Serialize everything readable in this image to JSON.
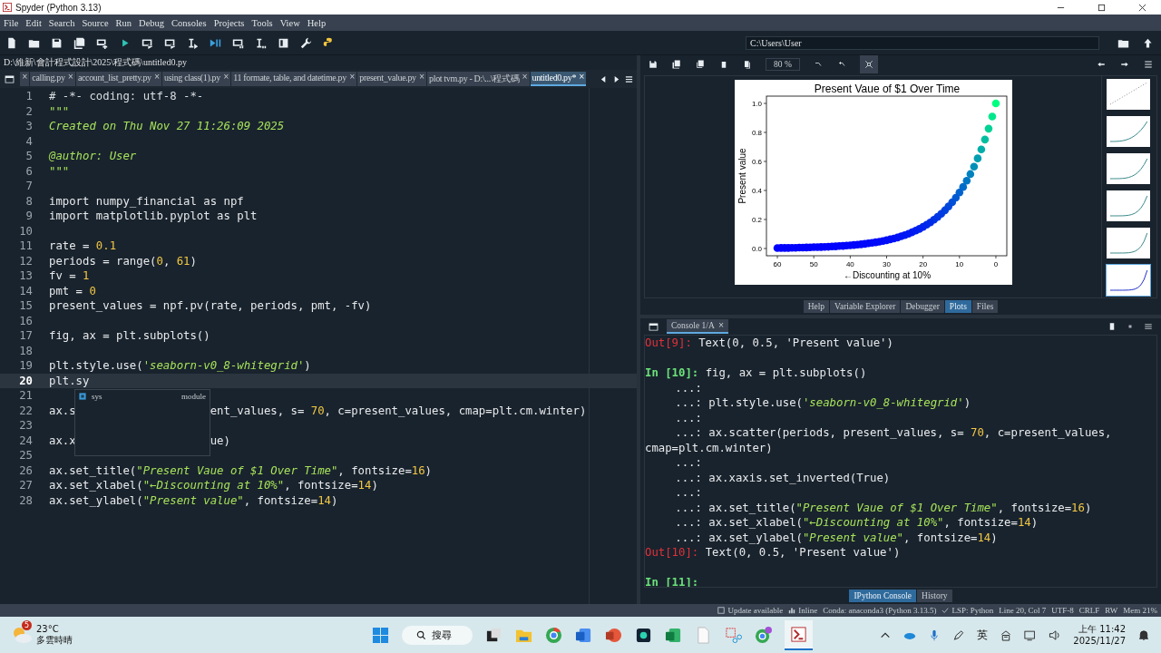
{
  "window": {
    "title": "Spyder (Python 3.13)"
  },
  "menu": [
    "File",
    "Edit",
    "Search",
    "Source",
    "Run",
    "Debug",
    "Consoles",
    "Projects",
    "Tools",
    "View",
    "Help"
  ],
  "working_dir": {
    "value": "C:\\Users\\User"
  },
  "editor": {
    "path": "D:\\維新\\會計程式設計\\2025\\程式碼\\untitled0.py",
    "tabs": [
      {
        "close": "×",
        "selected": false
      },
      {
        "label": "calling.py",
        "close": "×",
        "selected": false
      },
      {
        "label": "account_list_pretty.py",
        "close": "×",
        "selected": false
      },
      {
        "label": "using class(1).py",
        "close": "×",
        "selected": false
      },
      {
        "label": "11 formate, table, and datetime.py",
        "close": "×",
        "selected": false
      },
      {
        "label": "present_value.py",
        "close": "×",
        "selected": false
      },
      {
        "label": "plot tvm.py - D:\\...\\程式碼",
        "close": "×",
        "selected": false
      },
      {
        "label": "untitled0.py*",
        "close": "×",
        "selected": true
      }
    ],
    "lines": [
      {
        "n": "1",
        "tokens": [
          {
            "t": "# -*- coding: utf-8 -*-",
            "kind": "com"
          }
        ]
      },
      {
        "n": "2",
        "tokens": [
          {
            "t": "\"\"\"",
            "kind": "str"
          }
        ]
      },
      {
        "n": "3",
        "tokens": [
          {
            "t": "Created on Thu Nov 27 11:26:09 2025",
            "kind": "str"
          }
        ]
      },
      {
        "n": "4"
      },
      {
        "n": "5",
        "tokens": [
          {
            "t": "@author: User",
            "kind": "str"
          }
        ]
      },
      {
        "n": "6",
        "tokens": [
          {
            "t": "\"\"\"",
            "kind": "str"
          }
        ]
      },
      {
        "n": "7"
      },
      {
        "n": "8",
        "tokens": [
          {
            "t": "import numpy_financial as npf"
          }
        ]
      },
      {
        "n": "9",
        "tokens": [
          {
            "t": "import matplotlib.pyplot as plt"
          }
        ]
      },
      {
        "n": "10"
      },
      {
        "n": "11",
        "tokens": [
          {
            "t": "rate = "
          },
          {
            "t": "0.1",
            "kind": "num"
          }
        ]
      },
      {
        "n": "12",
        "tokens": [
          {
            "t": "periods = range("
          },
          {
            "t": "0",
            "kind": "num"
          },
          {
            "t": ", "
          },
          {
            "t": "61",
            "kind": "num"
          },
          {
            "t": ")"
          }
        ]
      },
      {
        "n": "13",
        "tokens": [
          {
            "t": "fv = "
          },
          {
            "t": "1",
            "kind": "num"
          }
        ]
      },
      {
        "n": "14",
        "tokens": [
          {
            "t": "pmt = "
          },
          {
            "t": "0",
            "kind": "num"
          }
        ]
      },
      {
        "n": "15",
        "tokens": [
          {
            "t": "present_values = npf.pv(rate, periods, pmt, -fv)"
          }
        ]
      },
      {
        "n": "16"
      },
      {
        "n": "17",
        "tokens": [
          {
            "t": "fig, ax = plt.subplots()"
          }
        ]
      },
      {
        "n": "18"
      },
      {
        "n": "19",
        "tokens": [
          {
            "t": "plt.style.use("
          },
          {
            "t": "'seaborn-v0_8-whitegrid'",
            "kind": "str"
          },
          {
            "t": ")"
          }
        ]
      },
      {
        "n": "20",
        "current": true,
        "tokens": [
          {
            "t": "plt.sy"
          }
        ]
      },
      {
        "n": "21"
      },
      {
        "n": "22",
        "covered": true,
        "tokens": [
          {
            "t": "ax.s"
          },
          {
            "t": "ent_values, s= "
          },
          {
            "t": "70",
            "kind": "num"
          },
          {
            "t": ", c=present_values, cmap=plt.cm.winter)"
          }
        ]
      },
      {
        "n": "23"
      },
      {
        "n": "24",
        "covered": true,
        "tokens": [
          {
            "t": "ax.x"
          },
          {
            "t": "ue)"
          }
        ]
      },
      {
        "n": "25"
      },
      {
        "n": "26",
        "tokens": [
          {
            "t": "ax.set_title("
          },
          {
            "t": "\"Present Vaue of $1 Over Time\"",
            "kind": "str"
          },
          {
            "t": ", fontsize="
          },
          {
            "t": "16",
            "kind": "num"
          },
          {
            "t": ")"
          }
        ]
      },
      {
        "n": "27",
        "tokens": [
          {
            "t": "ax.set_xlabel("
          },
          {
            "t": "\"←Discounting at 10%\"",
            "kind": "str"
          },
          {
            "t": ", fontsize="
          },
          {
            "t": "14",
            "kind": "num"
          },
          {
            "t": ")"
          }
        ]
      },
      {
        "n": "28",
        "tokens": [
          {
            "t": "ax.set_ylabel("
          },
          {
            "t": "\"Present value\"",
            "kind": "str"
          },
          {
            "t": ", fontsize="
          },
          {
            "t": "14",
            "kind": "num"
          },
          {
            "t": ")"
          }
        ]
      }
    ],
    "completion": {
      "items": [
        {
          "label": "sys",
          "type": "module"
        }
      ]
    }
  },
  "plots": {
    "zoom": "80 %",
    "chart_data": {
      "type": "scatter",
      "title": "Present Vaue of $1 Over Time",
      "xlabel": "←Discounting at 10%",
      "ylabel": "Present value",
      "x": [
        0,
        1,
        2,
        3,
        4,
        5,
        6,
        7,
        8,
        9,
        10,
        11,
        12,
        13,
        14,
        15,
        16,
        17,
        18,
        19,
        20,
        21,
        22,
        23,
        24,
        25,
        26,
        27,
        28,
        29,
        30,
        31,
        32,
        33,
        34,
        35,
        36,
        37,
        38,
        39,
        40,
        41,
        42,
        43,
        44,
        45,
        46,
        47,
        48,
        49,
        50,
        51,
        52,
        53,
        54,
        55,
        56,
        57,
        58,
        59,
        60
      ],
      "series": [
        {
          "values": [
            1.0,
            0.909,
            0.826,
            0.751,
            0.683,
            0.621,
            0.564,
            0.513,
            0.467,
            0.424,
            0.386,
            0.35,
            0.319,
            0.29,
            0.263,
            0.239,
            0.218,
            0.198,
            0.18,
            0.164,
            0.149,
            0.135,
            0.123,
            0.112,
            0.102,
            0.092,
            0.084,
            0.076,
            0.069,
            0.063,
            0.057,
            0.052,
            0.047,
            0.043,
            0.039,
            0.036,
            0.032,
            0.029,
            0.027,
            0.024,
            0.022,
            0.02,
            0.018,
            0.017,
            0.015,
            0.014,
            0.012,
            0.011,
            0.01,
            0.009,
            0.009,
            0.008,
            0.007,
            0.006,
            0.006,
            0.005,
            0.005,
            0.004,
            0.004,
            0.004,
            0.003
          ]
        }
      ],
      "xlim": [
        63,
        -3
      ],
      "ylim": [
        -0.05,
        1.05
      ],
      "xticks": [
        60,
        50,
        40,
        30,
        20,
        10,
        0
      ],
      "yticks": [
        {
          "value": 0,
          "label": "0.0"
        },
        {
          "value": 0.2,
          "label": "0.2"
        },
        {
          "value": 0.4,
          "label": "0.4"
        },
        {
          "value": 0.6,
          "label": "0.6"
        },
        {
          "value": 0.8,
          "label": "0.8"
        },
        {
          "value": 1,
          "label": "1.0"
        }
      ]
    },
    "thumbnails": [
      {
        "selected": false
      },
      {
        "selected": false
      },
      {
        "selected": false
      },
      {
        "selected": false
      },
      {
        "selected": false
      },
      {
        "selected": true
      }
    ]
  },
  "pane_tabs": [
    {
      "label": "Help",
      "selected": false
    },
    {
      "label": "Variable Explorer",
      "selected": false
    },
    {
      "label": "Debugger",
      "selected": false
    },
    {
      "label": "Plots",
      "selected": true
    },
    {
      "label": "Files",
      "selected": false
    }
  ],
  "console": {
    "tab": {
      "label": "Console 1/A",
      "close": "×"
    },
    "lines": [
      {
        "p": "Out[9]:",
        "kind": "out",
        "tokens": [
          {
            "t": "Text(0, 0.5, 'Present value')"
          }
        ]
      },
      {
        "p": "In [10]:",
        "kind": "in",
        "tokens": [
          {
            "t": "fig, ax = plt.subplots()"
          }
        ]
      },
      {
        "p": "...:",
        "kind": "cont"
      },
      {
        "p": "...:",
        "kind": "cont",
        "tokens": [
          {
            "t": "plt.style.use("
          },
          {
            "t": "'seaborn-v0_8-whitegrid'",
            "kind": "str"
          },
          {
            "t": ")"
          }
        ]
      },
      {
        "p": "...:",
        "kind": "cont"
      },
      {
        "p": "...:",
        "kind": "cont",
        "tokens": [
          {
            "t": "ax.scatter(periods, present_values, s= "
          },
          {
            "t": "70",
            "kind": "num"
          },
          {
            "t": ", c=present_values,"
          }
        ]
      },
      {
        "kind": "wrap",
        "tokens": [
          {
            "t": "cmap=plt.cm.winter)"
          }
        ]
      },
      {
        "p": "...:",
        "kind": "cont"
      },
      {
        "p": "...:",
        "kind": "cont",
        "tokens": [
          {
            "t": "ax.xaxis.set_inverted(True)"
          }
        ]
      },
      {
        "p": "...:",
        "kind": "cont"
      },
      {
        "p": "...:",
        "kind": "cont",
        "tokens": [
          {
            "t": "ax.set_title("
          },
          {
            "t": "\"Present Vaue of $1 Over Time\"",
            "kind": "str"
          },
          {
            "t": ", fontsize="
          },
          {
            "t": "16",
            "kind": "num"
          },
          {
            "t": ")"
          }
        ]
      },
      {
        "p": "...:",
        "kind": "cont",
        "tokens": [
          {
            "t": "ax.set_xlabel("
          },
          {
            "t": "\"←Discounting at 10%\"",
            "kind": "str"
          },
          {
            "t": ", fontsize="
          },
          {
            "t": "14",
            "kind": "num"
          },
          {
            "t": ")"
          }
        ]
      },
      {
        "p": "...:",
        "kind": "cont",
        "tokens": [
          {
            "t": "ax.set_ylabel("
          },
          {
            "t": "\"Present value\"",
            "kind": "str"
          },
          {
            "t": ", fontsize="
          },
          {
            "t": "14",
            "kind": "num"
          },
          {
            "t": ")"
          }
        ]
      },
      {
        "p": "Out[10]:",
        "kind": "out",
        "tokens": [
          {
            "t": "Text(0, 0.5, 'Present value')"
          }
        ]
      },
      {
        "p": "In [11]:",
        "kind": "in"
      }
    ],
    "tabs": [
      {
        "label": "IPython Console",
        "selected": true
      },
      {
        "label": "History",
        "selected": false
      }
    ]
  },
  "status_bar": [
    "Update available",
    "Inline",
    "Conda: anaconda3 (Python 3.13.5)",
    "LSP: Python",
    "Line 20, Col 7",
    "UTF-8",
    "CRLF",
    "RW",
    "Mem 21%"
  ],
  "taskbar": {
    "weather": {
      "badge": "5",
      "temp": "23°C",
      "desc": "多雲時晴"
    },
    "search": "搜尋",
    "ime": "英",
    "time": "上午 11:42",
    "date": "2025/11/27"
  }
}
